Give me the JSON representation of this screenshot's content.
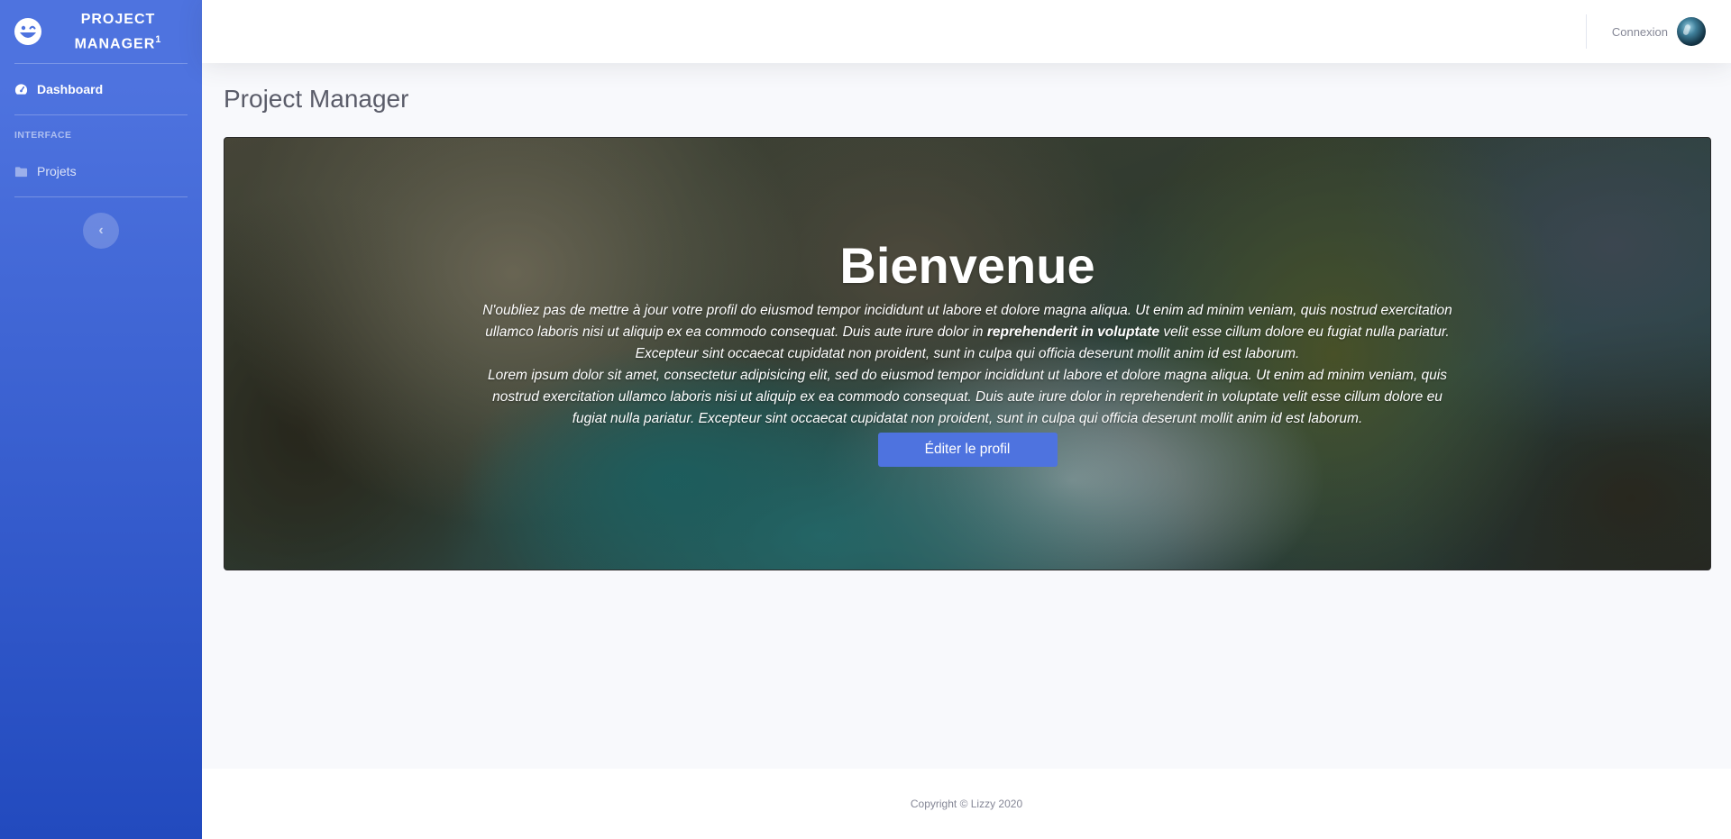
{
  "sidebar": {
    "brand": {
      "name": "PROJECT MANAGER",
      "sup": "1",
      "icon": "laugh-wink-icon"
    },
    "items": [
      {
        "label": "Dashboard",
        "icon": "tachometer-icon",
        "active": true
      },
      {
        "label": "Projets",
        "icon": "folder-icon",
        "active": false
      }
    ],
    "heading": "Interface",
    "toggle_glyph": "‹"
  },
  "topbar": {
    "user_label": "Connexion"
  },
  "main": {
    "page_title": "Project Manager",
    "hero": {
      "title": "Bienvenue",
      "paragraph1_part1": "N'oubliez pas de mettre à jour votre profil do eiusmod tempor incididunt ut labore et dolore magna aliqua. Ut enim ad minim veniam, quis nostrud exercitation ullamco laboris nisi ut aliquip ex ea commodo consequat. Duis aute irure dolor in ",
      "paragraph1_bold": "reprehenderit in voluptate",
      "paragraph1_part2": " velit esse cillum dolore eu fugiat nulla pariatur. Excepteur sint occaecat cupidatat non proident, sunt in culpa qui officia deserunt mollit anim id est laborum.",
      "paragraph2": "Lorem ipsum dolor sit amet, consectetur adipisicing elit, sed do eiusmod tempor incididunt ut labore et dolore magna aliqua. Ut enim ad minim veniam, quis nostrud exercitation ullamco laboris nisi ut aliquip ex ea commodo consequat. Duis aute irure dolor in reprehenderit in voluptate velit esse cillum dolore eu fugiat nulla pariatur. Excepteur sint occaecat cupidatat non proident, sunt in culpa qui officia deserunt mollit anim id est laborum.",
      "button_label": "Éditer le profil"
    }
  },
  "footer": {
    "copyright": "Copyright © Lizzy 2020"
  },
  "colors": {
    "primary": "#4e73df",
    "primary_dark": "#224abe",
    "text_muted": "#858796",
    "title_gray": "#5a5c69"
  }
}
